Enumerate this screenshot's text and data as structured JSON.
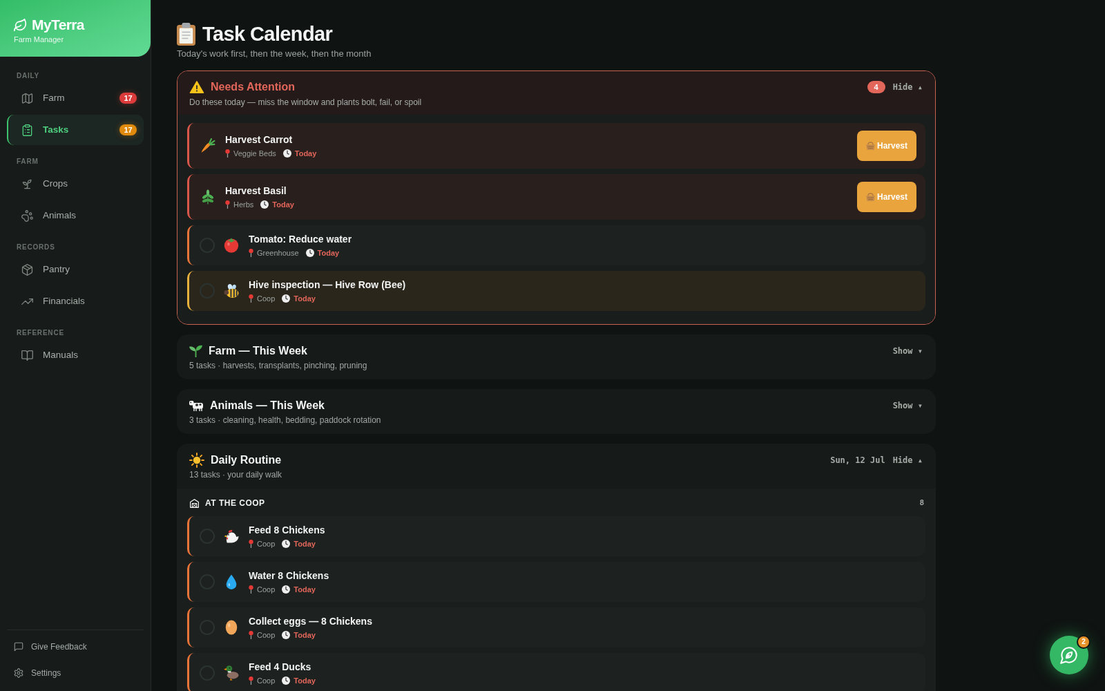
{
  "sidebar": {
    "brand": {
      "name": "MyTerra",
      "tagline": "Farm Manager"
    },
    "groups": [
      {
        "heading": "DAILY",
        "items": [
          {
            "label": "Farm",
            "selected": false,
            "badge": {
              "text": "17",
              "color": "#dc3b3b"
            }
          },
          {
            "label": "Tasks",
            "selected": true,
            "badge": {
              "text": "17",
              "color": "#e08a0e"
            }
          }
        ]
      },
      {
        "heading": "FARM",
        "items": [
          {
            "label": "Crops",
            "selected": false
          },
          {
            "label": "Animals",
            "selected": false
          }
        ]
      },
      {
        "heading": "RECORDS",
        "items": [
          {
            "label": "Pantry",
            "selected": false
          },
          {
            "label": "Financials",
            "selected": false
          }
        ]
      },
      {
        "heading": "REFERENCE",
        "items": [
          {
            "label": "Manuals",
            "selected": false
          }
        ]
      }
    ],
    "footer": [
      {
        "label": "Give Feedback"
      },
      {
        "label": "Settings"
      }
    ]
  },
  "page": {
    "title": "Task Calendar",
    "subtitle": "Today's work first, then the week, then the month"
  },
  "sections": [
    {
      "kind": "attention",
      "title": "Needs Attention",
      "subtitle": "Do these today — miss the window and plants bolt, fail, or spoil",
      "count": "4",
      "toggle": "Hide ▴",
      "expanded": true,
      "tasks": [
        {
          "kind": "harvest",
          "title": "Harvest Carrot",
          "location": "Veggie Beds",
          "due": "Today",
          "color": "#d9574a",
          "highlighted": true,
          "action": "Harvest"
        },
        {
          "kind": "harvest",
          "title": "Harvest Basil",
          "location": "Herbs",
          "due": "Today",
          "color": "#d9574a",
          "highlighted": true,
          "action": "Harvest"
        },
        {
          "kind": "check",
          "title": "Tomato: Reduce water",
          "location": "Greenhouse",
          "due": "Today",
          "color": "#e8743a",
          "highlighted": false,
          "checked": false
        },
        {
          "kind": "check",
          "title": "Hive inspection — Hive Row (Bee)",
          "location": "Coop",
          "due": "Today",
          "color": "#e8b03d",
          "highlighted": true,
          "checked": false
        }
      ]
    },
    {
      "kind": "plain",
      "title": "Farm — This Week",
      "subtitle": "5 tasks · harvests, transplants, pinching, pruning",
      "toggle": "Show ▾",
      "expanded": false
    },
    {
      "kind": "plain",
      "title": "Animals — This Week",
      "subtitle": "3 tasks · cleaning, health, bedding, paddock rotation",
      "toggle": "Show ▾",
      "expanded": false
    },
    {
      "kind": "plain",
      "title": "Daily Routine",
      "subtitle": "13 tasks · your daily walk",
      "date": "Sun, 12 Jul",
      "toggle": "Hide ▴",
      "expanded": true,
      "groups": [
        {
          "heading": "AT THE COOP",
          "count": "8",
          "tasks": [
            {
              "kind": "check",
              "title": "Feed 8 Chickens",
              "location": "Coop",
              "due": "Today",
              "color": "#e8743a",
              "highlighted": false,
              "checked": false
            },
            {
              "kind": "check",
              "title": "Water 8 Chickens",
              "location": "Coop",
              "due": "Today",
              "color": "#e8743a",
              "highlighted": false,
              "checked": false
            },
            {
              "kind": "check",
              "title": "Collect eggs — 8 Chickens",
              "location": "Coop",
              "due": "Today",
              "color": "#e8743a",
              "highlighted": false,
              "checked": false
            },
            {
              "kind": "check",
              "title": "Feed 4 Ducks",
              "location": "Coop",
              "due": "Today",
              "color": "#e8743a",
              "highlighted": false,
              "checked": false
            }
          ]
        }
      ]
    }
  ],
  "chat_button": {
    "badge": "2"
  }
}
